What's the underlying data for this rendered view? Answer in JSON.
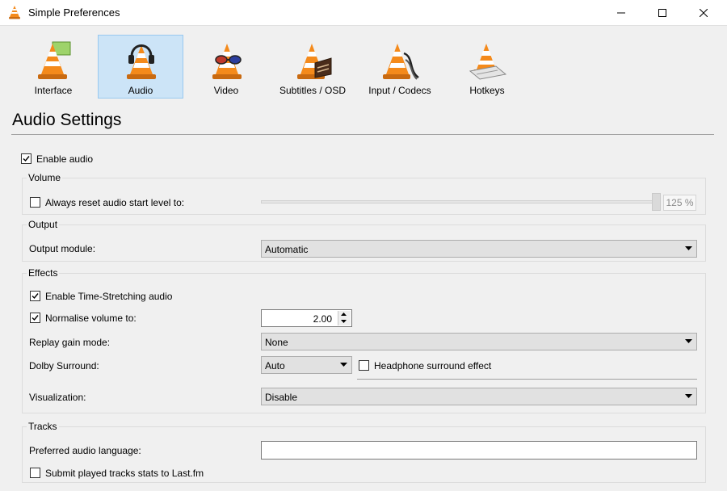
{
  "window": {
    "title": "Simple Preferences"
  },
  "colors": {
    "selected_bg": "#cce4f7",
    "cone_orange": "#f48a1b"
  },
  "toolbar": {
    "items": [
      {
        "label": "Interface",
        "icon": "vlc-cone-interface-icon"
      },
      {
        "label": "Audio",
        "icon": "vlc-cone-headphones-icon",
        "selected": true
      },
      {
        "label": "Video",
        "icon": "vlc-cone-glasses-icon"
      },
      {
        "label": "Subtitles / OSD",
        "icon": "vlc-cone-subtitles-icon"
      },
      {
        "label": "Input / Codecs",
        "icon": "vlc-cone-cables-icon"
      },
      {
        "label": "Hotkeys",
        "icon": "vlc-cone-keyboard-icon"
      }
    ]
  },
  "page": {
    "heading": "Audio Settings"
  },
  "enable_audio": {
    "label": "Enable audio",
    "checked": true
  },
  "volume": {
    "title": "Volume",
    "reset_label": "Always reset audio start level to:",
    "reset_checked": false,
    "level_text": "125 %",
    "level_percent": 125,
    "level_max": 125
  },
  "output": {
    "title": "Output",
    "module_label": "Output module:",
    "module_value": "Automatic"
  },
  "effects": {
    "title": "Effects",
    "time_stretch_label": "Enable Time-Stretching audio",
    "time_stretch_checked": true,
    "normalise_label": "Normalise volume to:",
    "normalise_checked": true,
    "normalise_value": "2.00",
    "replay_label": "Replay gain mode:",
    "replay_value": "None",
    "dolby_label": "Dolby Surround:",
    "dolby_value": "Auto",
    "headphone_label": "Headphone surround effect",
    "headphone_checked": false,
    "viz_label": "Visualization:",
    "viz_value": "Disable"
  },
  "tracks": {
    "title": "Tracks",
    "language_label": "Preferred audio language:",
    "language_value": "",
    "lastfm_label": "Submit played tracks stats to Last.fm",
    "lastfm_checked": false
  }
}
